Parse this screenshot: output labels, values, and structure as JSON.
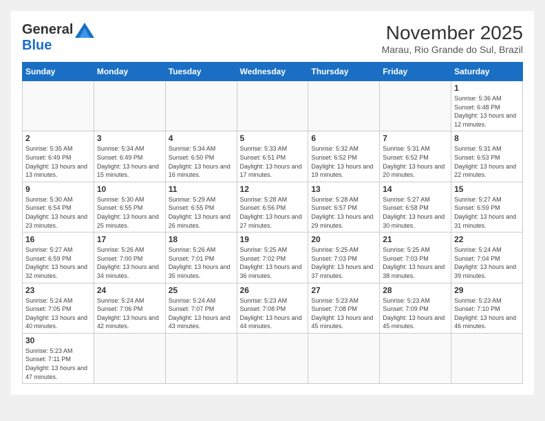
{
  "logo": {
    "general": "General",
    "blue": "Blue"
  },
  "title": {
    "month": "November 2025",
    "location": "Marau, Rio Grande do Sul, Brazil"
  },
  "weekdays": [
    "Sunday",
    "Monday",
    "Tuesday",
    "Wednesday",
    "Thursday",
    "Friday",
    "Saturday"
  ],
  "weeks": [
    [
      {
        "day": null
      },
      {
        "day": null
      },
      {
        "day": null
      },
      {
        "day": null
      },
      {
        "day": null
      },
      {
        "day": null
      },
      {
        "day": 1,
        "sunrise": "5:36 AM",
        "sunset": "6:48 PM",
        "daylight": "13 hours and 12 minutes."
      }
    ],
    [
      {
        "day": 2,
        "sunrise": "5:35 AM",
        "sunset": "6:49 PM",
        "daylight": "13 hours and 13 minutes."
      },
      {
        "day": 3,
        "sunrise": "5:34 AM",
        "sunset": "6:49 PM",
        "daylight": "13 hours and 15 minutes."
      },
      {
        "day": 4,
        "sunrise": "5:34 AM",
        "sunset": "6:50 PM",
        "daylight": "13 hours and 16 minutes."
      },
      {
        "day": 5,
        "sunrise": "5:33 AM",
        "sunset": "6:51 PM",
        "daylight": "13 hours and 17 minutes."
      },
      {
        "day": 6,
        "sunrise": "5:32 AM",
        "sunset": "6:52 PM",
        "daylight": "13 hours and 19 minutes."
      },
      {
        "day": 7,
        "sunrise": "5:31 AM",
        "sunset": "6:52 PM",
        "daylight": "13 hours and 20 minutes."
      },
      {
        "day": 8,
        "sunrise": "5:31 AM",
        "sunset": "6:53 PM",
        "daylight": "13 hours and 22 minutes."
      }
    ],
    [
      {
        "day": 9,
        "sunrise": "5:30 AM",
        "sunset": "6:54 PM",
        "daylight": "13 hours and 23 minutes."
      },
      {
        "day": 10,
        "sunrise": "5:30 AM",
        "sunset": "6:55 PM",
        "daylight": "13 hours and 25 minutes."
      },
      {
        "day": 11,
        "sunrise": "5:29 AM",
        "sunset": "6:55 PM",
        "daylight": "13 hours and 26 minutes."
      },
      {
        "day": 12,
        "sunrise": "5:28 AM",
        "sunset": "6:56 PM",
        "daylight": "13 hours and 27 minutes."
      },
      {
        "day": 13,
        "sunrise": "5:28 AM",
        "sunset": "6:57 PM",
        "daylight": "13 hours and 29 minutes."
      },
      {
        "day": 14,
        "sunrise": "5:27 AM",
        "sunset": "6:58 PM",
        "daylight": "13 hours and 30 minutes."
      },
      {
        "day": 15,
        "sunrise": "5:27 AM",
        "sunset": "6:59 PM",
        "daylight": "13 hours and 31 minutes."
      }
    ],
    [
      {
        "day": 16,
        "sunrise": "5:27 AM",
        "sunset": "6:59 PM",
        "daylight": "13 hours and 32 minutes."
      },
      {
        "day": 17,
        "sunrise": "5:26 AM",
        "sunset": "7:00 PM",
        "daylight": "13 hours and 34 minutes."
      },
      {
        "day": 18,
        "sunrise": "5:26 AM",
        "sunset": "7:01 PM",
        "daylight": "13 hours and 35 minutes."
      },
      {
        "day": 19,
        "sunrise": "5:25 AM",
        "sunset": "7:02 PM",
        "daylight": "13 hours and 36 minutes."
      },
      {
        "day": 20,
        "sunrise": "5:25 AM",
        "sunset": "7:03 PM",
        "daylight": "13 hours and 37 minutes."
      },
      {
        "day": 21,
        "sunrise": "5:25 AM",
        "sunset": "7:03 PM",
        "daylight": "13 hours and 38 minutes."
      },
      {
        "day": 22,
        "sunrise": "5:24 AM",
        "sunset": "7:04 PM",
        "daylight": "13 hours and 39 minutes."
      }
    ],
    [
      {
        "day": 23,
        "sunrise": "5:24 AM",
        "sunset": "7:05 PM",
        "daylight": "13 hours and 40 minutes."
      },
      {
        "day": 24,
        "sunrise": "5:24 AM",
        "sunset": "7:06 PM",
        "daylight": "13 hours and 42 minutes."
      },
      {
        "day": 25,
        "sunrise": "5:24 AM",
        "sunset": "7:07 PM",
        "daylight": "13 hours and 43 minutes."
      },
      {
        "day": 26,
        "sunrise": "5:23 AM",
        "sunset": "7:08 PM",
        "daylight": "13 hours and 44 minutes."
      },
      {
        "day": 27,
        "sunrise": "5:23 AM",
        "sunset": "7:08 PM",
        "daylight": "13 hours and 45 minutes."
      },
      {
        "day": 28,
        "sunrise": "5:23 AM",
        "sunset": "7:09 PM",
        "daylight": "13 hours and 45 minutes."
      },
      {
        "day": 29,
        "sunrise": "5:23 AM",
        "sunset": "7:10 PM",
        "daylight": "13 hours and 46 minutes."
      }
    ],
    [
      {
        "day": 30,
        "sunrise": "5:23 AM",
        "sunset": "7:11 PM",
        "daylight": "13 hours and 47 minutes."
      },
      {
        "day": null
      },
      {
        "day": null
      },
      {
        "day": null
      },
      {
        "day": null
      },
      {
        "day": null
      },
      {
        "day": null
      }
    ]
  ]
}
